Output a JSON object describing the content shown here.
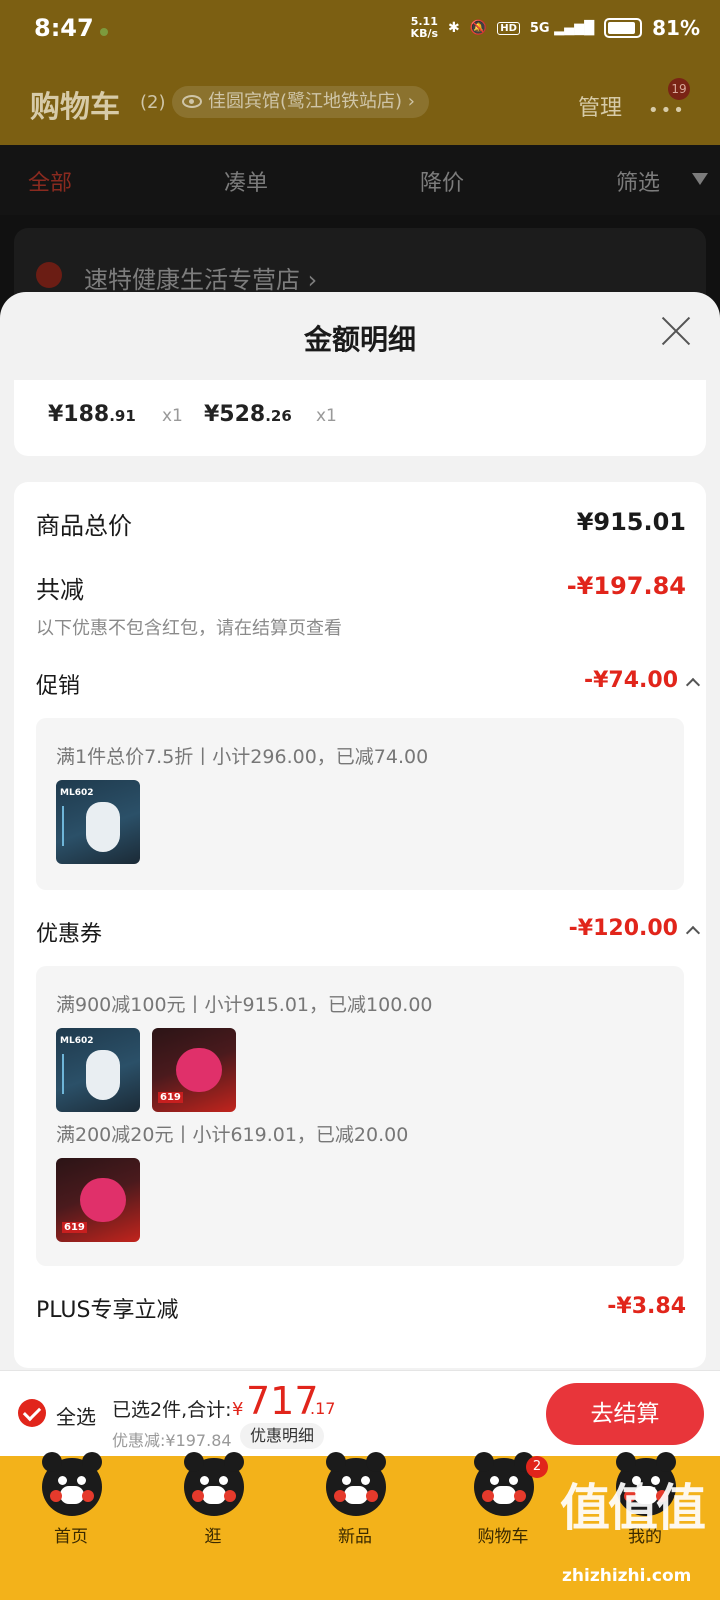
{
  "status_bar": {
    "time": "8:47",
    "speed_top": "5.11",
    "speed_bottom": "KB/s",
    "hd": "HD",
    "network": "5G",
    "battery": "81%"
  },
  "header": {
    "title": "购物车",
    "count": "(2)",
    "address": "佳圆宾馆(鹭江地铁站店)",
    "address_chevron": "›",
    "manage": "管理",
    "more": "•••",
    "badge": "19"
  },
  "tabs": [
    {
      "label": "全部"
    },
    {
      "label": "凑单"
    },
    {
      "label": "降价"
    },
    {
      "label": "筛选"
    }
  ],
  "store": {
    "name": "速特健康生活专营店 ›"
  },
  "sheet": {
    "title": "金额明细",
    "items": [
      {
        "price_int": "¥188",
        "price_dec": ".91",
        "qty": "x1"
      },
      {
        "price_int": "¥528",
        "price_dec": ".26",
        "qty": "x1"
      }
    ],
    "total_label": "商品总价",
    "total_value": "¥915.01",
    "discount_label": "共减",
    "discount_value": "-¥197.84",
    "discount_note": "以下优惠不包含红包，请在结算页查看",
    "promo": {
      "label": "促销",
      "value": "-¥74.00",
      "line": "满1件总价7.5折丨小计296.00，已减74.00"
    },
    "coupon": {
      "label": "优惠券",
      "value": "-¥120.00",
      "line1": "满900减100元丨小计915.01，已减100.00",
      "line2": "满200减20元丨小计619.01，已减20.00"
    },
    "plus": {
      "label": "PLUS专享立减",
      "value": "-¥3.84"
    },
    "thumb_white_tag": "ML602",
    "thumb_pink_tag": "619"
  },
  "checkout": {
    "select_all": "全选",
    "selected_text": "已选2件,合计:",
    "yen": "¥",
    "total_int": "717",
    "total_dec": ".17",
    "saved": "优惠减:¥197.84",
    "detail_button": "优惠明细",
    "pay_button": "去结算"
  },
  "tabbar": [
    {
      "label": "首页"
    },
    {
      "label": "逛"
    },
    {
      "label": "新品"
    },
    {
      "label": "购物车",
      "badge": "2"
    },
    {
      "label": "我的"
    }
  ],
  "watermark": {
    "text": "值值值",
    "sub": "zhizhizhi.com"
  },
  "colors": {
    "accent_red": "#e1251b",
    "tabbar_yellow": "#f3b21a",
    "pay_button": "#e8353a"
  }
}
